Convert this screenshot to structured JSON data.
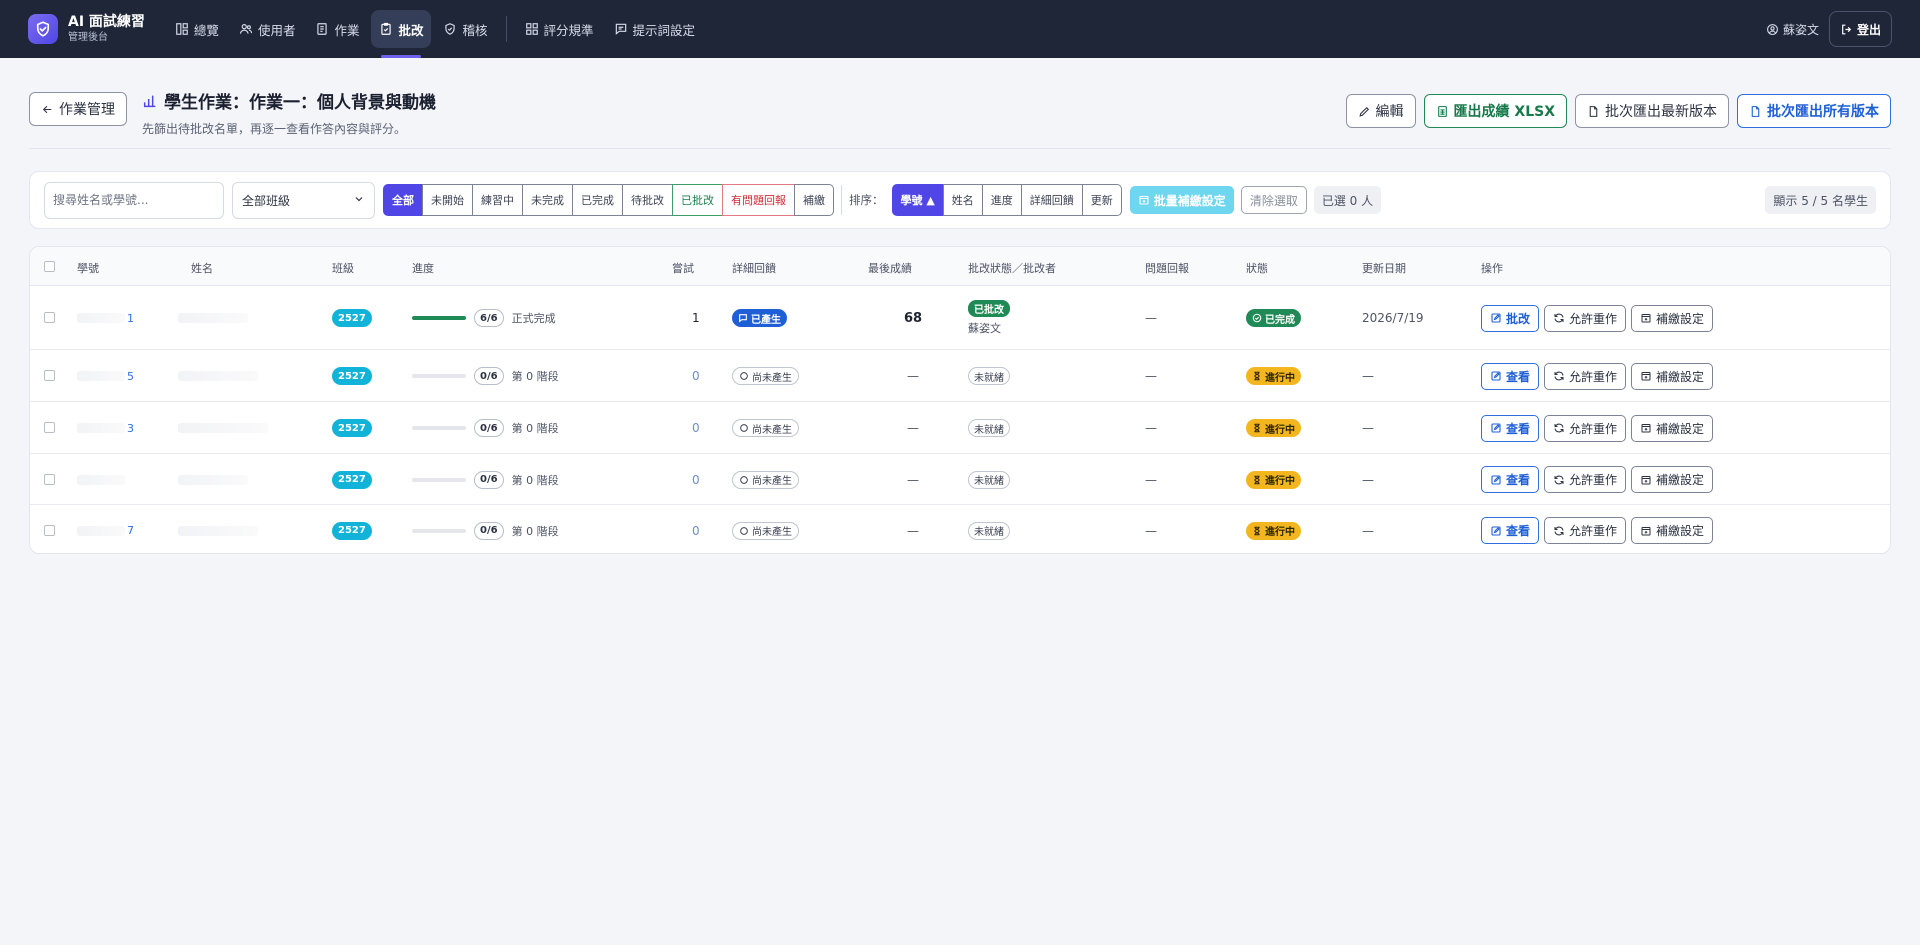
{
  "brand": {
    "title": "AI 面試練習",
    "subtitle": "管理後台"
  },
  "nav": {
    "items": [
      {
        "label": "總覽",
        "icon": "dashboard-icon"
      },
      {
        "label": "使用者",
        "icon": "users-icon"
      },
      {
        "label": "作業",
        "icon": "document-icon"
      },
      {
        "label": "批改",
        "icon": "clipboard-check-icon",
        "active": true
      },
      {
        "label": "稽核",
        "icon": "shield-check-icon"
      },
      {
        "label": "評分規準",
        "icon": "grid-icon"
      },
      {
        "label": "提示詞設定",
        "icon": "message-icon"
      }
    ],
    "user": "蘇姿文",
    "logout": "登出"
  },
  "header": {
    "back_label": "作業管理",
    "title": "學生作業：作業一：個人背景與動機",
    "subtitle": "先篩出待批改名單，再逐一查看作答內容與評分。",
    "actions": {
      "edit": "編輯",
      "export_xlsx": "匯出成績 XLSX",
      "batch_latest": "批次匯出最新版本",
      "batch_all": "批次匯出所有版本"
    }
  },
  "filters": {
    "search_placeholder": "搜尋姓名或學號...",
    "class_select": "全部班級",
    "status_tabs": [
      "全部",
      "未開始",
      "練習中",
      "未完成",
      "已完成",
      "待批改",
      "已批改",
      "有問題回報",
      "補繳"
    ],
    "sort_label": "排序：",
    "sort_tabs": [
      "學號 ▲",
      "姓名",
      "進度",
      "詳細回饋",
      "更新"
    ],
    "bulk_button": "批量補繳設定",
    "clear_button": "清除選取",
    "selected_count": "已選 0 人",
    "showing_count": "顯示 5 / 5 名學生"
  },
  "table": {
    "headers": [
      "學號",
      "姓名",
      "班級",
      "進度",
      "嘗試",
      "詳細回饋",
      "最後成績",
      "批改狀態／批改者",
      "問題回報",
      "狀態",
      "更新日期",
      "操作"
    ],
    "rows": [
      {
        "sid_tail": "1",
        "class": "2527",
        "progress": "6/6",
        "progress_fraction": 1.0,
        "progress_text": "正式完成",
        "attempts": "1",
        "feedback": "已產生",
        "feedback_done": true,
        "score": "68",
        "grade_status": "已批改",
        "grader": "蘇姿文",
        "issues": "—",
        "status": "已完成",
        "status_done": true,
        "date": "2026/7/19",
        "primary_action": "批改",
        "reset_action": "允許重作",
        "makeup_action": "補繳設定"
      },
      {
        "sid_tail": "5",
        "class": "2527",
        "progress": "0/6",
        "progress_fraction": 0.0,
        "progress_text": "第 0 階段",
        "attempts": "0",
        "feedback": "尚未產生",
        "feedback_done": false,
        "score": "—",
        "grade_status": "未就緒",
        "grader": "",
        "issues": "—",
        "status": "進行中",
        "status_done": false,
        "date": "—",
        "primary_action": "查看",
        "reset_action": "允許重作",
        "makeup_action": "補繳設定"
      },
      {
        "sid_tail": "3",
        "class": "2527",
        "progress": "0/6",
        "progress_fraction": 0.0,
        "progress_text": "第 0 階段",
        "attempts": "0",
        "feedback": "尚未產生",
        "feedback_done": false,
        "score": "—",
        "grade_status": "未就緒",
        "grader": "",
        "issues": "—",
        "status": "進行中",
        "status_done": false,
        "date": "—",
        "primary_action": "查看",
        "reset_action": "允許重作",
        "makeup_action": "補繳設定"
      },
      {
        "sid_tail": "",
        "class": "2527",
        "progress": "0/6",
        "progress_fraction": 0.0,
        "progress_text": "第 0 階段",
        "attempts": "0",
        "feedback": "尚未產生",
        "feedback_done": false,
        "score": "—",
        "grade_status": "未就緒",
        "grader": "",
        "issues": "—",
        "status": "進行中",
        "status_done": false,
        "date": "—",
        "primary_action": "查看",
        "reset_action": "允許重作",
        "makeup_action": "補繳設定"
      },
      {
        "sid_tail": "7",
        "class": "2527",
        "progress": "0/6",
        "progress_fraction": 0.0,
        "progress_text": "第 0 階段",
        "attempts": "0",
        "feedback": "尚未產生",
        "feedback_done": false,
        "score": "—",
        "grade_status": "未就緒",
        "grader": "",
        "issues": "—",
        "status": "進行中",
        "status_done": false,
        "date": "—",
        "primary_action": "查看",
        "reset_action": "允許重作",
        "makeup_action": "補繳設定"
      }
    ]
  },
  "colors": {
    "nav_bg": "#1f2638",
    "accent": "#4f46e5",
    "green": "#1f8a55",
    "blue": "#2f6fe0",
    "cyan": "#12b3d8",
    "amber": "#f3b61f",
    "red": "#d02b3a"
  }
}
